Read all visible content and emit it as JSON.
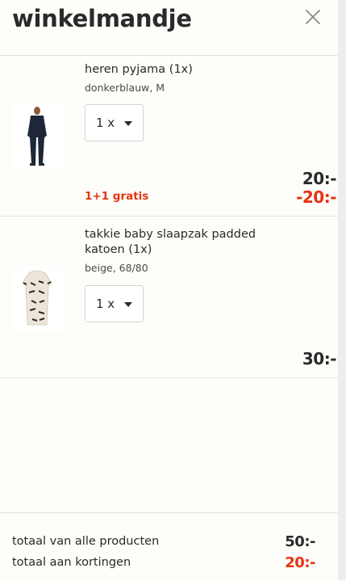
{
  "cart": {
    "title": "winkelmandje",
    "close_icon": "close-icon"
  },
  "items": [
    {
      "name": "heren pyjama (1x)",
      "variant": "donkerblauw, M",
      "quantity": "1 x",
      "price": "20:-",
      "promo_label": "1+1 gratis",
      "promo_price": "-20:-",
      "image_icon": "pyjama-image"
    },
    {
      "name": "takkie baby slaapzak padded katoen (1x)",
      "variant": "beige, 68/80",
      "quantity": "1 x",
      "price": "30:-",
      "image_icon": "sleeping-bag-image"
    }
  ],
  "totals": {
    "products_label": "totaal van alle producten",
    "products_value": "50:-",
    "discounts_label": "totaal aan kortingen",
    "discounts_value": "20:-"
  },
  "colors": {
    "accent_red": "#e63312",
    "text": "#2a2a2a",
    "background": "#fdfdf9"
  }
}
